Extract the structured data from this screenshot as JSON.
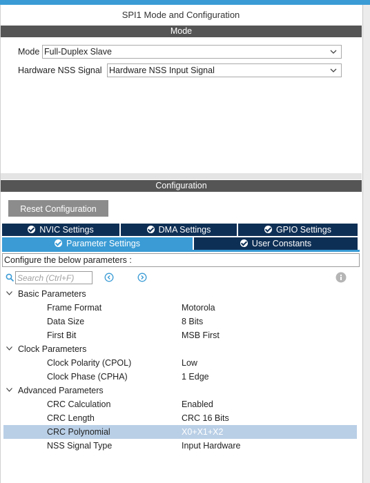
{
  "title": "SPI1 Mode and Configuration",
  "mode_section": {
    "header": "Mode",
    "mode_label": "Mode",
    "mode_value": "Full-Duplex Slave",
    "nss_label": "Hardware NSS Signal",
    "nss_value": "Hardware NSS Input Signal"
  },
  "config_section": {
    "header": "Configuration",
    "reset_button": "Reset Configuration",
    "tabs_row1": [
      "NVIC Settings",
      "DMA Settings",
      "GPIO Settings"
    ],
    "tabs_row2": [
      "Parameter Settings",
      "User Constants"
    ],
    "active_tab": "Parameter Settings",
    "configure_text": "Configure the below parameters :",
    "search_placeholder": "Search (Ctrl+F)",
    "icons": [
      "search-icon",
      "prev-circle-icon",
      "next-circle-icon",
      "info-icon",
      "check-circle-icon",
      "chevron-down-icon"
    ]
  },
  "parameters": {
    "basic": {
      "name": "Basic Parameters",
      "items": [
        {
          "name": "Frame Format",
          "value": "Motorola"
        },
        {
          "name": "Data Size",
          "value": "8 Bits"
        },
        {
          "name": "First Bit",
          "value": "MSB First"
        }
      ]
    },
    "clock": {
      "name": "Clock Parameters",
      "items": [
        {
          "name": "Clock Polarity (CPOL)",
          "value": "Low"
        },
        {
          "name": "Clock Phase (CPHA)",
          "value": "1 Edge"
        }
      ]
    },
    "advanced": {
      "name": "Advanced Parameters",
      "items": [
        {
          "name": "CRC Calculation",
          "value": "Enabled"
        },
        {
          "name": "CRC Length",
          "value": "CRC 16 Bits"
        },
        {
          "name": "CRC Polynomial",
          "value": "X0+X1+X2"
        },
        {
          "name": "NSS Signal Type",
          "value": "Input Hardware"
        }
      ]
    }
  },
  "colors": {
    "accent": "#3a9bd5",
    "tab_dark": "#0e2f55",
    "section_header": "#555555",
    "selected_row": "#b9cfe6",
    "button_gray": "#8c8c8c"
  }
}
